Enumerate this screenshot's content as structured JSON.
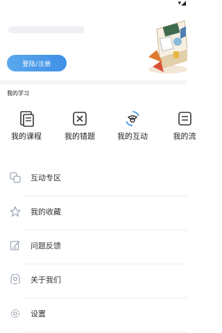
{
  "header": {
    "login_label": "登陆/注册"
  },
  "learning": {
    "title": "我的学习",
    "items": [
      {
        "label": "我的课程",
        "icon": "course-icon"
      },
      {
        "label": "我的错题",
        "icon": "wrong-questions-icon"
      },
      {
        "label": "我的互动",
        "icon": "interaction-icon"
      },
      {
        "label": "我的流",
        "icon": "record-icon"
      }
    ]
  },
  "menu": [
    {
      "label": "互动专区",
      "icon": "interaction-zone-icon"
    },
    {
      "label": "我的收藏",
      "icon": "star-icon"
    },
    {
      "label": "问题反馈",
      "icon": "feedback-icon"
    },
    {
      "label": "关于我们",
      "icon": "about-icon"
    },
    {
      "label": "设置",
      "icon": "settings-icon"
    }
  ],
  "colors": {
    "accent": "#4a9bea",
    "icon_gray": "#9aa3b3",
    "text": "#222222"
  }
}
